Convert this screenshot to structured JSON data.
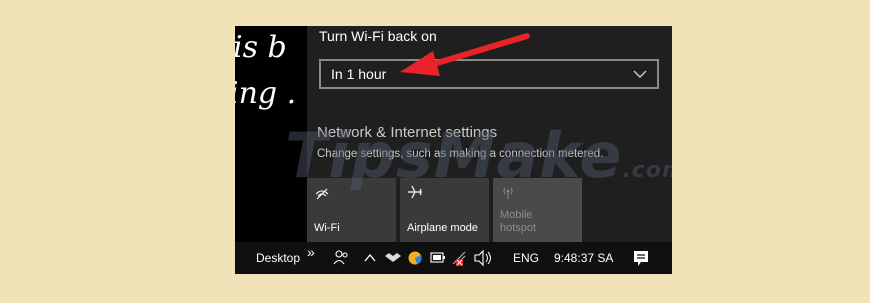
{
  "flyout": {
    "title": "Turn Wi-Fi back on",
    "dropdown_value": "In 1 hour",
    "network_settings_title": "Network & Internet settings",
    "network_settings_subtitle": "Change settings, such as making a connection metered."
  },
  "quick_actions": [
    {
      "label": "Wi-Fi",
      "icon": "wifi-off-icon"
    },
    {
      "label": "Airplane mode",
      "icon": "airplane-icon"
    },
    {
      "label_line1": "Mobile",
      "label_line2": "hotspot",
      "icon": "mobile-hotspot-icon",
      "disabled": true
    }
  ],
  "taskbar": {
    "desktop_label": "Desktop",
    "overflow": "»",
    "language": "ENG",
    "clock": "9:48:37 SA"
  },
  "wallpaper": {
    "line1": "is b",
    "line2": "ing ."
  },
  "watermark": {
    "main": "TipsMake",
    "suffix": ".com"
  },
  "colors": {
    "annotation_arrow": "#e8242a",
    "flyout_bg": "#1f1f1f",
    "page_bg": "#efe3b7"
  }
}
